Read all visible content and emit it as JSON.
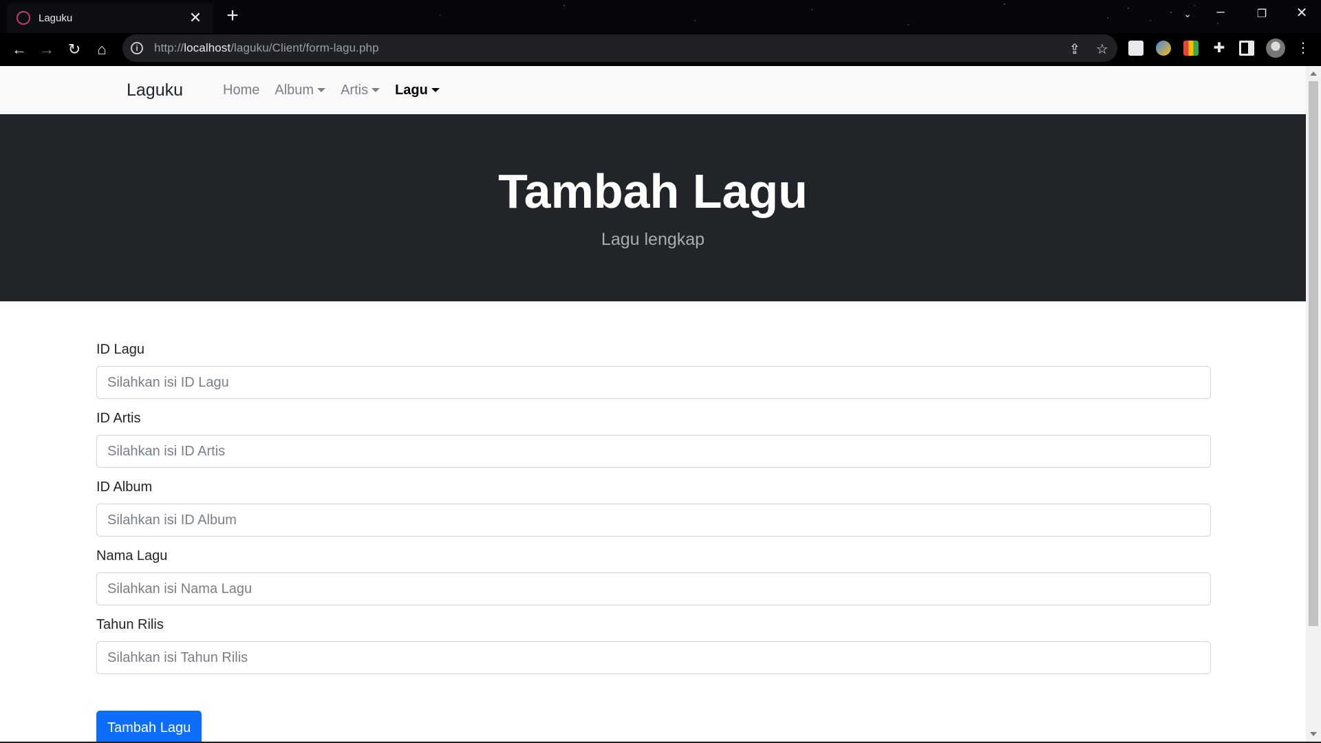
{
  "browser": {
    "tab_title": "Laguku",
    "tab_close": "✕",
    "new_tab": "+",
    "url_prefix": "http://",
    "url_host": "localhost",
    "url_path": "/laguku/Client/form-lagu.php",
    "icons": [
      "back-icon",
      "forward-icon",
      "reload-icon",
      "home-icon",
      "info-icon",
      "share-icon",
      "star-icon",
      "extensions-icon",
      "sidepanel-icon",
      "profile-icon",
      "menu-icon"
    ]
  },
  "navbar": {
    "brand": "Laguku",
    "links": [
      {
        "label": "Home",
        "dropdown": false,
        "active": false
      },
      {
        "label": "Album",
        "dropdown": true,
        "active": false
      },
      {
        "label": "Artis",
        "dropdown": true,
        "active": false
      },
      {
        "label": "Lagu",
        "dropdown": true,
        "active": true
      }
    ]
  },
  "hero": {
    "title": "Tambah Lagu",
    "subtitle": "Lagu lengkap"
  },
  "form": {
    "fields": [
      {
        "label": "ID Lagu",
        "placeholder": "Silahkan isi ID Lagu",
        "value": ""
      },
      {
        "label": "ID Artis",
        "placeholder": "Silahkan isi ID Artis",
        "value": ""
      },
      {
        "label": "ID Album",
        "placeholder": "Silahkan isi ID Album",
        "value": ""
      },
      {
        "label": "Nama Lagu",
        "placeholder": "Silahkan isi Nama Lagu",
        "value": ""
      },
      {
        "label": "Tahun Rilis",
        "placeholder": "Silahkan isi Tahun Rilis",
        "value": ""
      }
    ],
    "submit_label": "Tambah Lagu"
  },
  "colors": {
    "hero_bg": "#212529",
    "navbar_bg": "#f8f9fa",
    "primary": "#0d6efd"
  }
}
